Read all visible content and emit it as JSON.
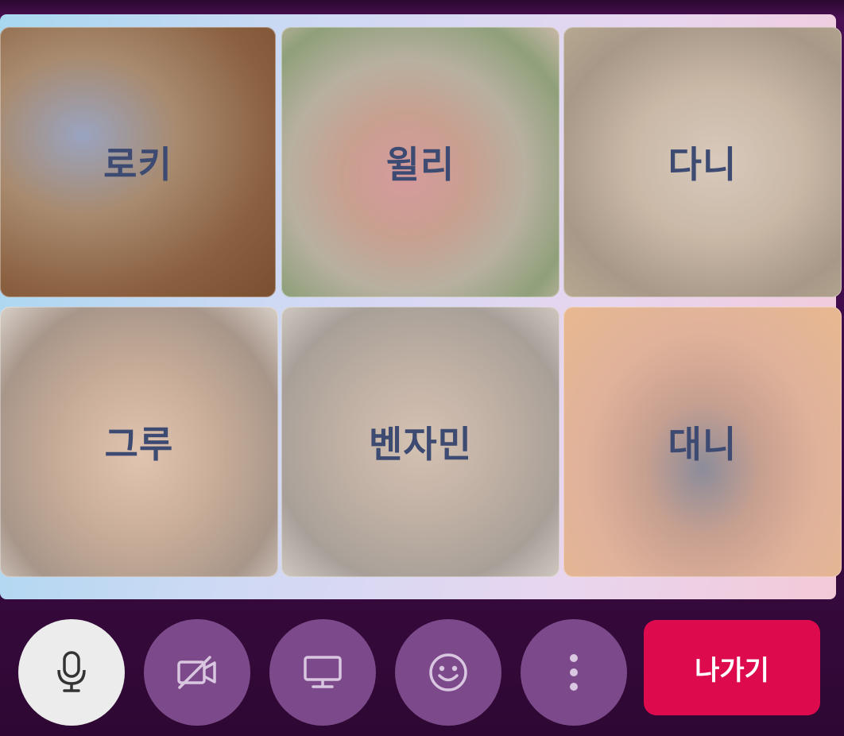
{
  "participants": [
    {
      "name": "로키"
    },
    {
      "name": "윌리"
    },
    {
      "name": "다니"
    },
    {
      "name": "그루"
    },
    {
      "name": "벤자민"
    },
    {
      "name": "대니"
    }
  ],
  "controls": {
    "mic_icon": "microphone-icon",
    "camera_icon": "camera-off-icon",
    "screen_share_icon": "monitor-icon",
    "reaction_icon": "smiley-icon",
    "more_icon": "vertical-dots-icon",
    "leave_label": "나가기"
  },
  "colors": {
    "leave_button": "#de0a4e",
    "control_button": "#7c4a8a",
    "mic_button": "#ececec",
    "name_text": "#3d4a72"
  }
}
